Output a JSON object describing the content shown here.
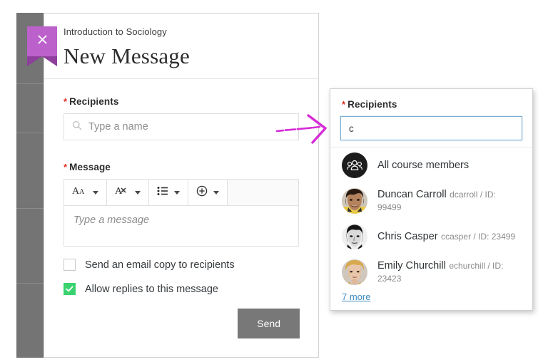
{
  "modal": {
    "course_name": "Introduction to Sociology",
    "title": "New Message",
    "close_icon": "close-x-icon",
    "recipients": {
      "label": "Recipients",
      "required_marker": "*",
      "search_icon": "search-icon",
      "placeholder": "Type a name",
      "value": ""
    },
    "message": {
      "label": "Message",
      "required_marker": "*",
      "placeholder": "Type a message",
      "value": "",
      "toolbar": [
        {
          "icon": "font-size-icon",
          "glyph": "Aa",
          "caret": "chevron-down-icon"
        },
        {
          "icon": "text-color-icon",
          "glyph": "A",
          "caret": "chevron-down-icon"
        },
        {
          "icon": "bulleted-list-icon",
          "glyph": "list",
          "caret": "chevron-down-icon"
        },
        {
          "icon": "insert-plus-icon",
          "glyph": "plus-circle",
          "caret": "chevron-down-icon"
        }
      ]
    },
    "options": [
      {
        "label": "Send an email copy to recipients",
        "checked": false
      },
      {
        "label": "Allow replies to this message",
        "checked": true
      }
    ],
    "send_label": "Send"
  },
  "annotation": {
    "type": "hand-drawn-arrow",
    "color": "#d62bd6",
    "points_to": "recipients-input"
  },
  "autocomplete": {
    "label": "Recipients",
    "required_marker": "*",
    "input_value": "c",
    "items": [
      {
        "name": "All course members",
        "sub": "",
        "avatar": "group-icon",
        "avatar_type": "group"
      },
      {
        "name": "Duncan Carroll",
        "sub": "dcarroll / ID: 99499",
        "avatar": "avatar-photo",
        "avatar_type": "photo-duncan"
      },
      {
        "name": "Chris Casper",
        "sub": "ccasper / ID: 23499",
        "avatar": "avatar-photo",
        "avatar_type": "photo-chris"
      },
      {
        "name": "Emily Churchill",
        "sub": "echurchill / ID: 23423",
        "avatar": "avatar-photo",
        "avatar_type": "photo-emily"
      }
    ],
    "more_link": "7 more"
  },
  "colors": {
    "accent_purple": "#bc61cb",
    "accent_purple_dark": "#8e3f9c",
    "required_red": "#e0301e",
    "checked_green": "#3ad36f",
    "send_gray": "#787878",
    "link_blue": "#3d8bbf",
    "focus_blue": "#7aadd4",
    "annotation_magenta": "#d62bd6"
  }
}
